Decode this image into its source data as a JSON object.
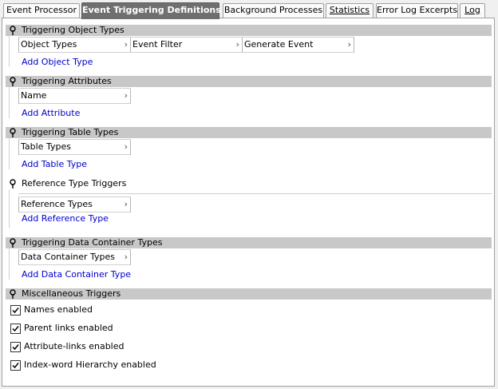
{
  "tabs": [
    {
      "label": "Event Processor",
      "active": false,
      "underlined": false
    },
    {
      "label": "Event Triggering Definitions",
      "active": true,
      "underlined": false
    },
    {
      "label": "Background Processes",
      "active": false,
      "underlined": false
    },
    {
      "label": "Statistics",
      "active": false,
      "underlined": true
    },
    {
      "label": "Error Log Excerpts",
      "active": false,
      "underlined": false
    },
    {
      "label": "Log",
      "active": false,
      "underlined": true
    }
  ],
  "sections": {
    "object_types": {
      "title": "Triggering Object Types",
      "columns": [
        "Object Types",
        "Event Filter",
        "Generate Event"
      ],
      "add_link": "Add Object Type"
    },
    "attributes": {
      "title": "Triggering Attributes",
      "columns": [
        "Name"
      ],
      "add_link": "Add Attribute"
    },
    "table_types": {
      "title": "Triggering Table Types",
      "columns": [
        "Table Types"
      ],
      "add_link": "Add Table Type"
    },
    "reference_types": {
      "title": "Reference Type Triggers",
      "columns": [
        "Reference Types"
      ],
      "add_link": "Add Reference Type"
    },
    "data_container_types": {
      "title": "Triggering Data Container Types",
      "columns": [
        "Data Container Types"
      ],
      "add_link": "Add Data Container Type"
    },
    "misc": {
      "title": "Miscellaneous Triggers",
      "checkboxes": [
        {
          "label": "Names enabled",
          "checked": true
        },
        {
          "label": "Parent links enabled",
          "checked": true
        },
        {
          "label": "Attribute-links enabled",
          "checked": true
        },
        {
          "label": "Index-word Hierarchy enabled",
          "checked": true
        }
      ]
    }
  },
  "icons": {
    "section_pin": "pin-icon",
    "column_menu": "chevron-right-icon",
    "checkbox_mark": "checkmark-icon"
  },
  "colors": {
    "section_header_bg": "#c8c8c8",
    "active_tab_bg": "#6f6f6f",
    "link": "#0000cc"
  }
}
